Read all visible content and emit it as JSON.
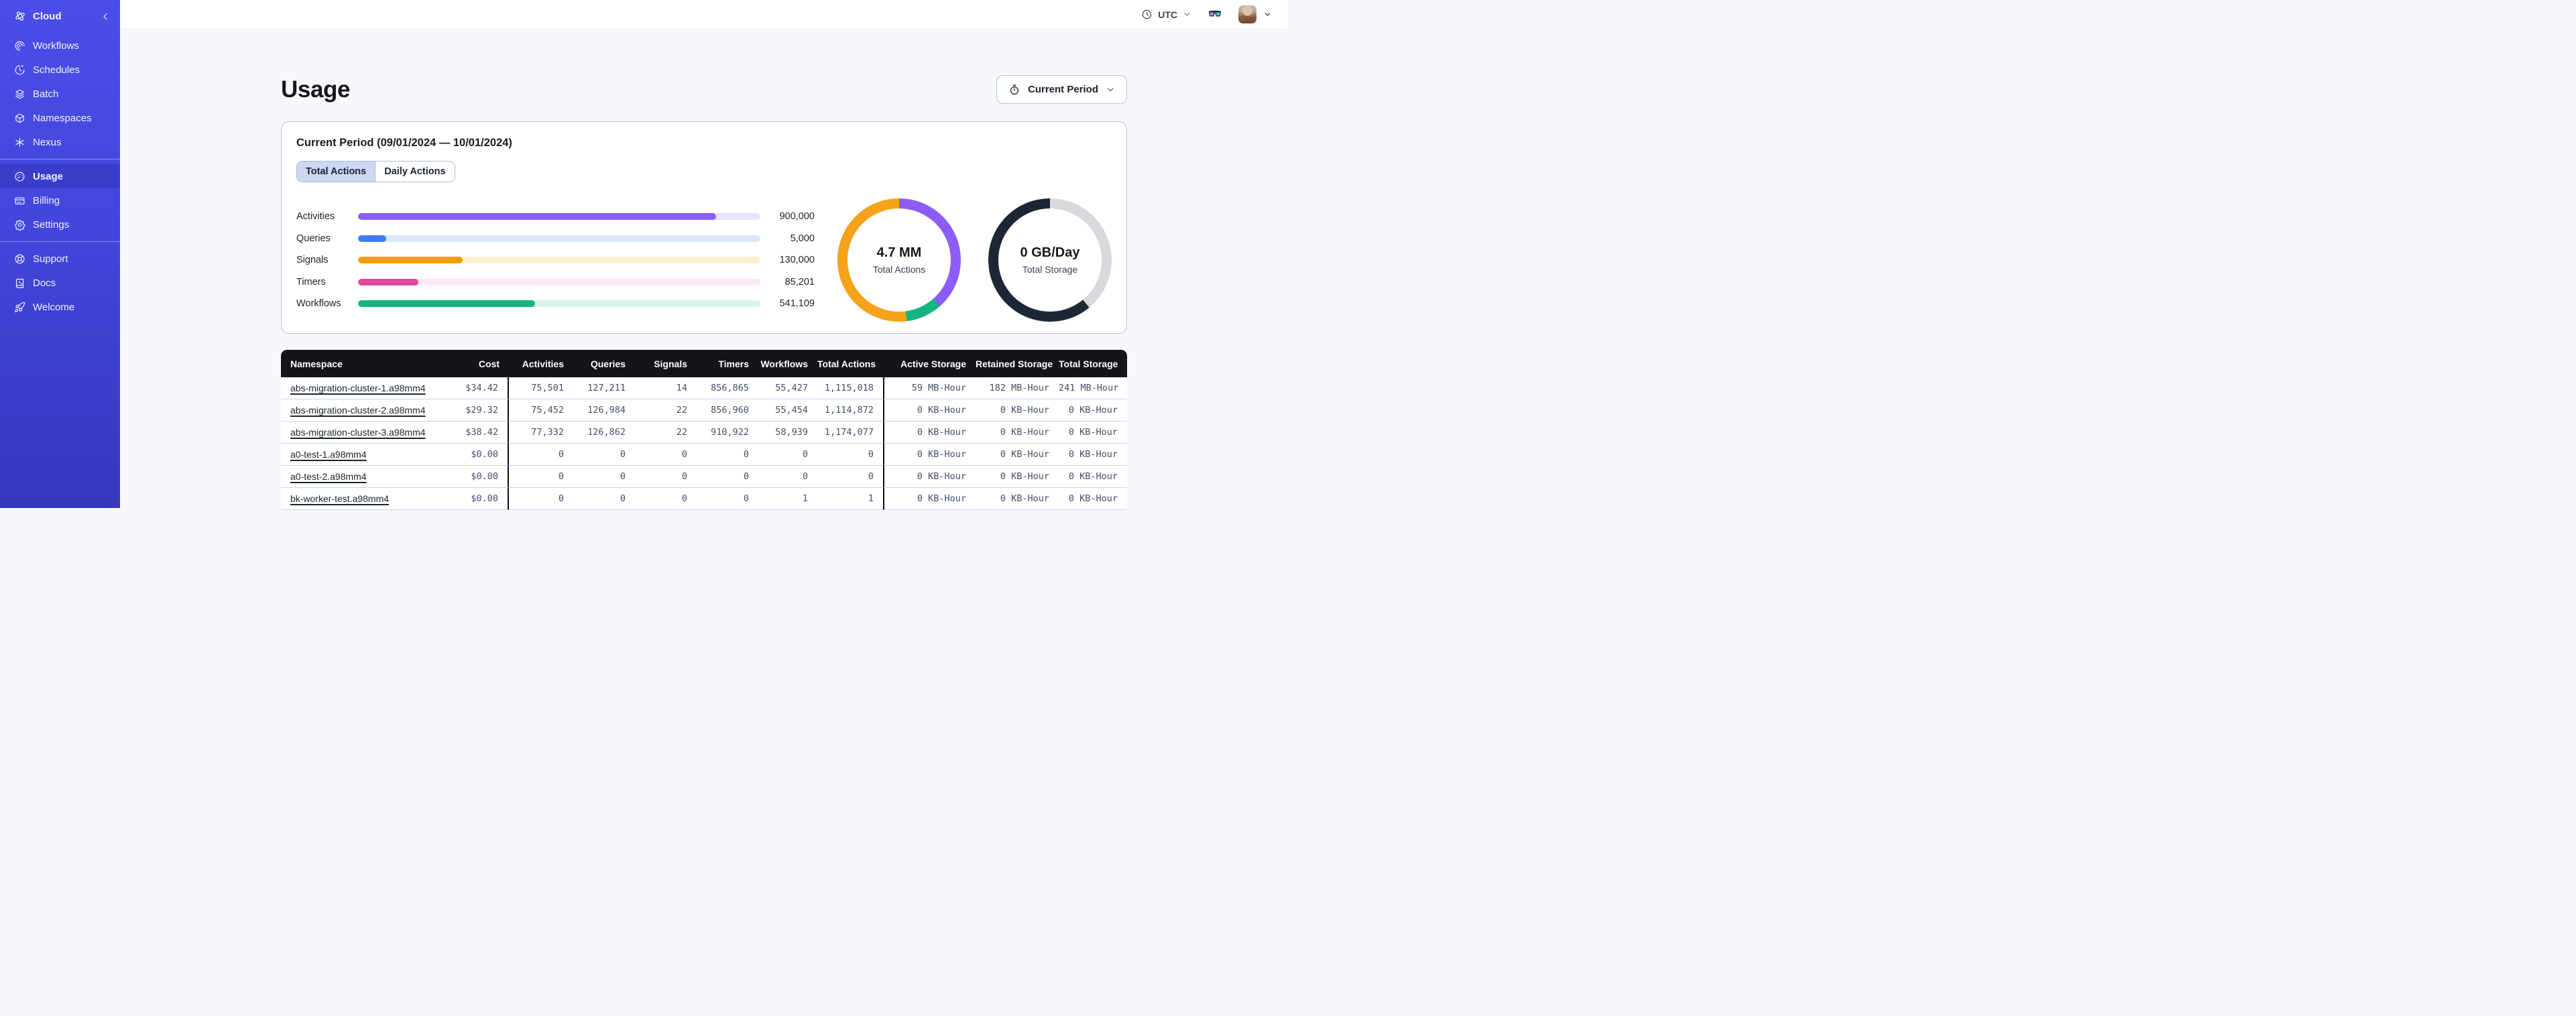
{
  "colors": {
    "sidebar_top": "#4a4de8",
    "sidebar_bottom": "#3538bc",
    "sidebar_active": "#3a3dca",
    "panel_border": "#b6c2e1",
    "tab_selected_bg": "#ccd7f1",
    "table_header_bg": "#151519",
    "row_divider": "#c7d2e8",
    "background": "#f7f8fc"
  },
  "sidebar": {
    "brand": {
      "label": "Cloud",
      "icon": "temporal-logo",
      "collapse_icon": "chevron-left"
    },
    "sections": [
      {
        "items": [
          {
            "label": "Workflows",
            "icon": "workflows"
          },
          {
            "label": "Schedules",
            "icon": "schedules"
          },
          {
            "label": "Batch",
            "icon": "batch"
          },
          {
            "label": "Namespaces",
            "icon": "namespaces"
          },
          {
            "label": "Nexus",
            "icon": "nexus"
          }
        ]
      },
      {
        "items": [
          {
            "label": "Usage",
            "icon": "usage",
            "active": true
          },
          {
            "label": "Billing",
            "icon": "billing"
          },
          {
            "label": "Settings",
            "icon": "settings"
          }
        ]
      },
      {
        "items": [
          {
            "label": "Support",
            "icon": "support"
          },
          {
            "label": "Docs",
            "icon": "docs"
          },
          {
            "label": "Welcome",
            "icon": "welcome"
          }
        ]
      }
    ]
  },
  "topbar": {
    "timezone": {
      "icon": "clock",
      "label": "UTC",
      "chevron": "chevron-down"
    },
    "glasses_icon": "glasses",
    "user_menu": {
      "chevron": "chevron-down"
    }
  },
  "page": {
    "title": "Usage",
    "period_selector": {
      "icon": "stopwatch",
      "label": "Current Period",
      "chevron": "chevron-down"
    }
  },
  "usage_panel": {
    "title": "Current Period (09/01/2024 — 10/01/2024)",
    "tabs": [
      {
        "label": "Total Actions",
        "active": true
      },
      {
        "label": "Daily Actions",
        "active": false
      }
    ],
    "bars": [
      {
        "label": "Activities",
        "value": "900,000",
        "pct": 89,
        "color": "#8b5cf6",
        "track": "#ebe4fc"
      },
      {
        "label": "Queries",
        "value": "5,000",
        "pct": 7,
        "color": "#3e7ef0",
        "track": "#d9e6fb"
      },
      {
        "label": "Signals",
        "value": "130,000",
        "pct": 26,
        "color": "#f39d0d",
        "track": "#fcf1cf"
      },
      {
        "label": "Timers",
        "value": "85,201",
        "pct": 15,
        "color": "#e4469b",
        "track": "#fbe7f6"
      },
      {
        "label": "Workflows",
        "value": "541,109",
        "pct": 44,
        "color": "#16b483",
        "track": "#d9f5e8"
      }
    ],
    "donuts": [
      {
        "value": "4.7 MM",
        "label": "Total Actions",
        "segments": [
          {
            "color": "#8b5cf6",
            "pct": 38.5
          },
          {
            "color": "#16b483",
            "pct": 9.5
          },
          {
            "color": "#f6a21a",
            "pct": 52
          }
        ]
      },
      {
        "value": "0 GB/Day",
        "label": "Total Storage",
        "segments": [
          {
            "color": "#d7d9df",
            "pct": 39
          },
          {
            "color": "#1c2634",
            "pct": 61
          }
        ]
      }
    ]
  },
  "table": {
    "columns": [
      "Namespace",
      "Cost",
      "Activities",
      "Queries",
      "Signals",
      "Timers",
      "Workflows",
      "Total Actions",
      "Active Storage",
      "Retained Storage",
      "Total Storage"
    ],
    "rows": [
      [
        "abs-migration-cluster-1.a98mm4",
        "$34.42",
        "75,501",
        "127,211",
        "14",
        "856,865",
        "55,427",
        "1,115,018",
        "59 MB-Hour",
        "182 MB-Hour",
        "241 MB-Hour"
      ],
      [
        "abs-migration-cluster-2.a98mm4",
        "$29.32",
        "75,452",
        "126,984",
        "22",
        "856,960",
        "55,454",
        "1,114,872",
        "0 KB-Hour",
        "0 KB-Hour",
        "0 KB-Hour"
      ],
      [
        "abs-migration-cluster-3.a98mm4",
        "$38.42",
        "77,332",
        "126,862",
        "22",
        "910,922",
        "58,939",
        "1,174,077",
        "0 KB-Hour",
        "0 KB-Hour",
        "0 KB-Hour"
      ],
      [
        "a0-test-1.a98mm4",
        "$0.00",
        "0",
        "0",
        "0",
        "0",
        "0",
        "0",
        "0 KB-Hour",
        "0 KB-Hour",
        "0 KB-Hour"
      ],
      [
        "a0-test-2.a98mm4",
        "$0.00",
        "0",
        "0",
        "0",
        "0",
        "0",
        "0",
        "0 KB-Hour",
        "0 KB-Hour",
        "0 KB-Hour"
      ],
      [
        "bk-worker-test.a98mm4",
        "$0.00",
        "0",
        "0",
        "0",
        "0",
        "1",
        "1",
        "0 KB-Hour",
        "0 KB-Hour",
        "0 KB-Hour"
      ]
    ]
  }
}
